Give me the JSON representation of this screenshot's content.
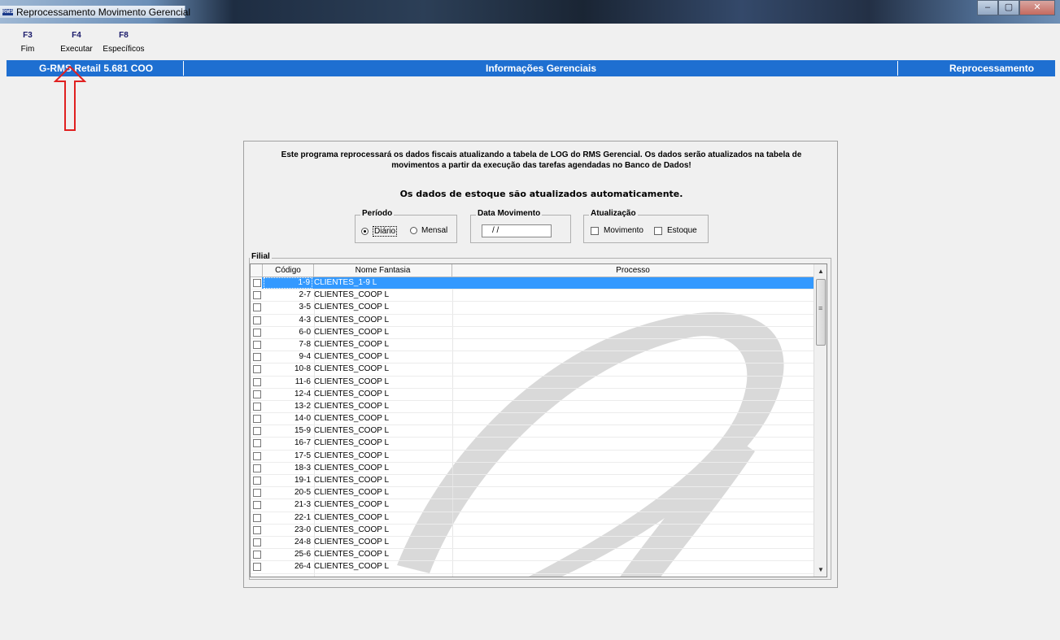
{
  "window": {
    "title": "Reprocessamento Movimento Gerencial",
    "icon": "rms-app-icon",
    "icon_label": "RMS",
    "min_glyph": "–",
    "max_glyph": "▢",
    "close_glyph": "✕"
  },
  "toolbar": [
    {
      "key": "F3",
      "label": "Fim"
    },
    {
      "key": "F4",
      "label": "Executar"
    },
    {
      "key": "F8",
      "label": "Específicos"
    }
  ],
  "header": {
    "left": "G-RMS Retail 5.681 COO",
    "center": "Informações Gerenciais",
    "right": "Reprocessamento",
    "color": "#1e6fd1"
  },
  "intro": {
    "line1": "Este programa reprocessará os dados fiscais atualizando a tabela de LOG do RMS Gerencial. Os dados serão atualizados na tabela de",
    "line2": "movimentos a partir da execução das tarefas agendadas no Banco de Dados!",
    "stock_note": "Os dados de estoque são atualizados automaticamente."
  },
  "periodo": {
    "caption": "Período",
    "options": [
      "Diário",
      "Mensal"
    ],
    "selected": "Diário"
  },
  "data_movimento": {
    "caption": "Data Movimento",
    "value": " / /"
  },
  "atualizacao": {
    "caption": "Atualização",
    "options": [
      "Movimento",
      "Estoque"
    ]
  },
  "filial": {
    "caption": "Filial",
    "columns": [
      "Código",
      "Nome Fantasia",
      "Processo"
    ],
    "rows": [
      {
        "code": "1-9",
        "name": "CLIENTES_1-9 L",
        "selected": true
      },
      {
        "code": "2-7",
        "name": "CLIENTES_COOP L"
      },
      {
        "code": "3-5",
        "name": "CLIENTES_COOP L"
      },
      {
        "code": "4-3",
        "name": "CLIENTES_COOP L"
      },
      {
        "code": "6-0",
        "name": "CLIENTES_COOP L"
      },
      {
        "code": "7-8",
        "name": "CLIENTES_COOP L"
      },
      {
        "code": "9-4",
        "name": "CLIENTES_COOP L"
      },
      {
        "code": "10-8",
        "name": "CLIENTES_COOP L"
      },
      {
        "code": "11-6",
        "name": "CLIENTES_COOP L"
      },
      {
        "code": "12-4",
        "name": "CLIENTES_COOP L"
      },
      {
        "code": "13-2",
        "name": "CLIENTES_COOP L"
      },
      {
        "code": "14-0",
        "name": "CLIENTES_COOP L"
      },
      {
        "code": "15-9",
        "name": "CLIENTES_COOP L"
      },
      {
        "code": "16-7",
        "name": "CLIENTES_COOP L"
      },
      {
        "code": "17-5",
        "name": "CLIENTES_COOP L"
      },
      {
        "code": "18-3",
        "name": "CLIENTES_COOP L"
      },
      {
        "code": "19-1",
        "name": "CLIENTES_COOP L"
      },
      {
        "code": "20-5",
        "name": "CLIENTES_COOP L"
      },
      {
        "code": "21-3",
        "name": "CLIENTES_COOP L"
      },
      {
        "code": "22-1",
        "name": "CLIENTES_COOP L"
      },
      {
        "code": "23-0",
        "name": "CLIENTES_COOP L"
      },
      {
        "code": "24-8",
        "name": "CLIENTES_COOP L"
      },
      {
        "code": "25-6",
        "name": "CLIENTES_COOP L"
      },
      {
        "code": "26-4",
        "name": "CLIENTES_COOP L"
      }
    ]
  },
  "colors": {
    "selection": "#3399ff",
    "arrow": "#e02020"
  }
}
